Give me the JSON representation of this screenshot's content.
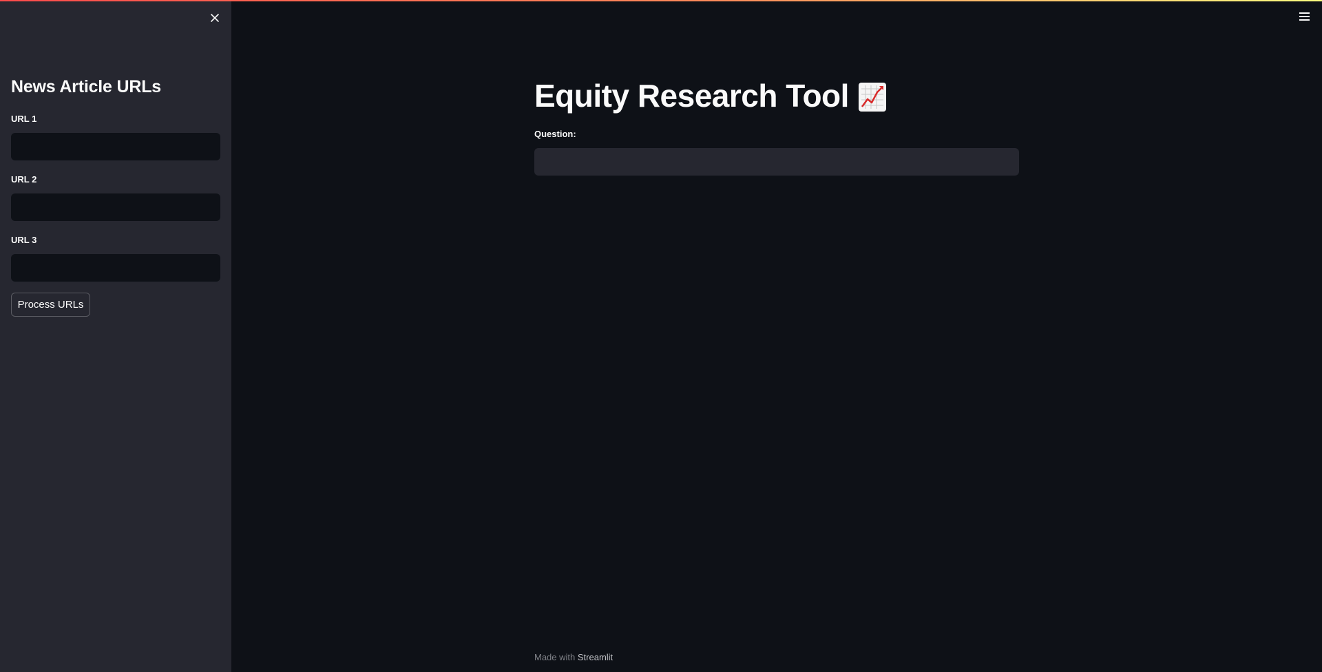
{
  "sidebar": {
    "header": "News Article URLs",
    "fields": [
      {
        "label": "URL 1",
        "value": ""
      },
      {
        "label": "URL 2",
        "value": ""
      },
      {
        "label": "URL 3",
        "value": ""
      }
    ],
    "process_button_label": "Process URLs",
    "close_icon": "close-icon"
  },
  "main": {
    "title": "Equity Research Tool",
    "title_icon": "chart-increasing-icon",
    "question_label": "Question:",
    "question_value": ""
  },
  "header": {
    "menu_icon": "hamburger-menu-icon"
  },
  "footer": {
    "prefix": "Made with",
    "link": "Streamlit"
  },
  "colors": {
    "background": "#0e1117",
    "sidebar": "#262730",
    "text": "#fafafa",
    "accent": "#ff4b4b"
  }
}
